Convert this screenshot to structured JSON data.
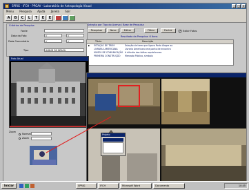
{
  "window": {
    "title": "SPRIG - IFCH - PPGAV - Laboratório de Antropologia Visual"
  },
  "menu": [
    "Menu",
    "Pesquisa",
    "Ajuda",
    "Janela",
    "Sair"
  ],
  "toolbar": {
    "letters": [
      "A",
      "B",
      "C",
      "L",
      "T",
      "E",
      "E"
    ]
  },
  "criteria": {
    "title": "Critérios de Pesquisa",
    "fields": [
      {
        "label": "Fonte",
        "value": ""
      },
      {
        "label": "Data da Foto",
        "value": "//",
        "extra": "//"
      },
      {
        "label": "Data Comentário",
        "value": "//",
        "extra": "//"
      },
      {
        "label": "Tipo",
        "value": "ÁLBUM DO BRASIL"
      }
    ]
  },
  "search_panel": {
    "title": "Seleção por Tipo do Acervo / Base de Pesquisa",
    "buttons": [
      "Pesquisar",
      "Novo",
      "Editar",
      "Filtrar",
      "Excluir"
    ],
    "checkbox_label": "Exibir Fotos",
    "result_title": "Resultado da Pesquisa: 6 Itens"
  },
  "results": {
    "columns": [
      "",
      "Título",
      "Descrição"
    ],
    "rows": [
      {
        "code": "",
        "title": "ESTAÇÃO DE TREM",
        "desc": "Estação de trem que ligava Porto Alegre ao"
      },
      {
        "code": "",
        "title": "LIVRARIA AMERICANA",
        "desc": "Livraria Americana era ponto de encontro"
      },
      {
        "code": "",
        "title": "MUSEU DE COMUNICAÇÃO",
        "desc": "A difusão das idéias republicanas"
      },
      {
        "code": "",
        "title": "PRIMEIRA CONSTRUÇÃO",
        "desc": "Mercado Público, símbolo"
      }
    ]
  },
  "photo_window": {
    "title": "Foto Atual",
    "zoom_label": "Zoom",
    "opts": [
      "Normal",
      "Zoom"
    ]
  },
  "viewer": {
    "title": "",
    "popup_title": "Projeto",
    "popup_items": [
      "",
      "",
      "",
      ""
    ]
  },
  "taskbar": {
    "start": "Iniciar",
    "tasks": [
      "SPRIG",
      "IFCH",
      "Microsoft Word",
      "Documento"
    ],
    "clock": "10:45"
  }
}
